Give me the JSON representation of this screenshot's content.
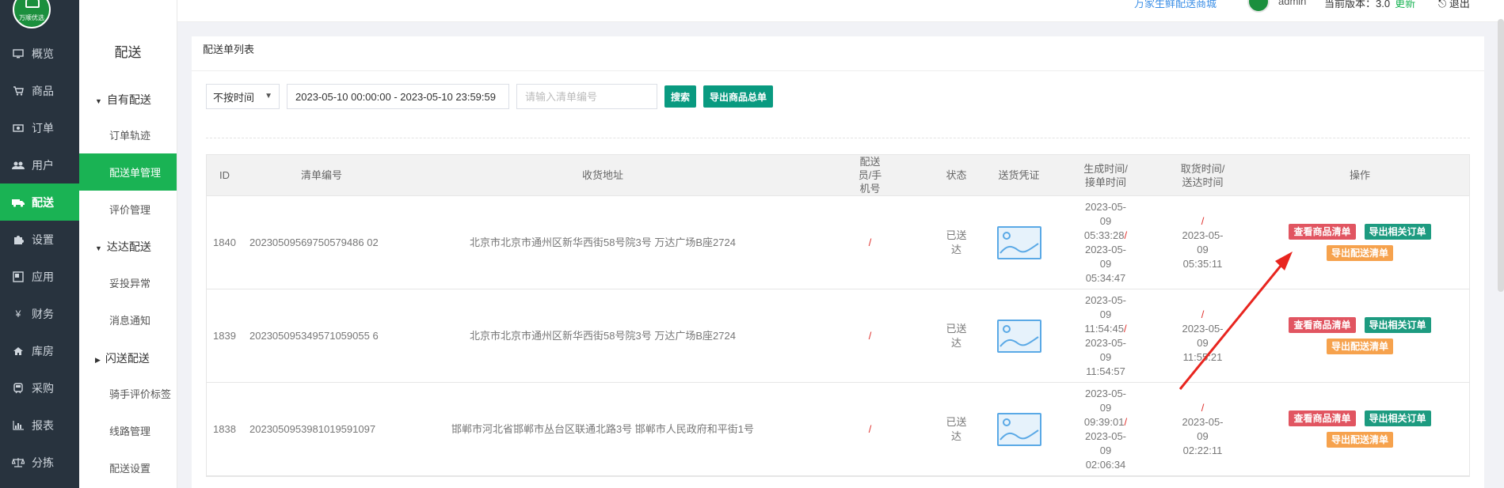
{
  "sidebar": {
    "logo_text": "万顺优选",
    "items": [
      {
        "label": "概览",
        "icon": "monitor-icon"
      },
      {
        "label": "商品",
        "icon": "cart-icon"
      },
      {
        "label": "订单",
        "icon": "money-icon"
      },
      {
        "label": "用户",
        "icon": "users-icon"
      },
      {
        "label": "配送",
        "icon": "truck-icon"
      },
      {
        "label": "设置",
        "icon": "puzzle-icon"
      },
      {
        "label": "应用",
        "icon": "app-icon"
      },
      {
        "label": "财务",
        "icon": "yen-icon"
      },
      {
        "label": "库房",
        "icon": "home-icon"
      },
      {
        "label": "采购",
        "icon": "train-icon"
      },
      {
        "label": "报表",
        "icon": "bar-chart-icon"
      },
      {
        "label": "分拣",
        "icon": "scale-icon"
      }
    ],
    "active_index": 4
  },
  "subsidebar": {
    "title": "配送",
    "groups": [
      {
        "label": "自有配送",
        "expanded": true
      },
      {
        "label": "达达配送",
        "expanded": true
      },
      {
        "label": "闪送配送",
        "expanded": false
      }
    ],
    "items": [
      "订单轨迹",
      "配送单管理",
      "评价管理",
      "妥投异常",
      "消息通知",
      "骑手评价标签",
      "线路管理",
      "配送设置"
    ],
    "active_item": "配送单管理"
  },
  "header": {
    "shop_link": "万家生鲜配送商城",
    "user": "admin",
    "version_label": "当前版本：3.0",
    "update_label": "更新",
    "logout_label": "退出"
  },
  "page": {
    "title": "配送单列表"
  },
  "filters": {
    "time_select": "不按时间",
    "date_range": "2023-05-10 00:00:00 - 2023-05-10 23:59:59",
    "code_placeholder": "请输入清单编号",
    "search_label": "搜索",
    "export_label": "导出商品总单"
  },
  "table": {
    "headers": {
      "id": "ID",
      "no": "清单编号",
      "addr": "收货地址",
      "rider": "配送员/手机号",
      "status": "状态",
      "proof": "送货凭证",
      "gen": "生成时间/接单时间",
      "take": "取货时间/送达时间",
      "op": "操作"
    },
    "rows": [
      {
        "id": "1840",
        "no": "20230509569750579486 02",
        "addr": "北京市北京市通州区新华西街58号院3号 万达广场B座2724",
        "rider": "/",
        "status": "已送达",
        "gen1": "2023-05-09 05:33:28",
        "gen2": "2023-05-09 05:34:47",
        "take1": "/",
        "take2": "2023-05-09 05:35:11"
      },
      {
        "id": "1839",
        "no": "202305095349571059055 6",
        "addr": "北京市北京市通州区新华西街58号院3号 万达广场B座2724",
        "rider": "/",
        "status": "已送达",
        "gen1": "2023-05-09 11:54:45",
        "gen2": "2023-05-09 11:54:57",
        "take1": "/",
        "take2": "2023-05-09 11:55:21"
      },
      {
        "id": "1838",
        "no": "2023050953981019591097",
        "addr": "邯郸市河北省邯郸市丛台区联通北路3号 邯郸市人民政府和平街1号",
        "rider": "/",
        "status": "已送达",
        "gen1": "2023-05-09 09:39:01",
        "gen2": "2023-05-09 02:06:34",
        "take1": "/",
        "take2": "2023-05-09 02:22:11"
      }
    ],
    "op_labels": {
      "view": "查看商品清单",
      "export_orders": "导出相关订单",
      "export_delivery": "导出配送清单"
    }
  },
  "colors": {
    "sidebar_bg": "#28333e",
    "active_green": "#1ab354",
    "teal_button": "#099a80",
    "tag_red": "#e15561",
    "tag_green": "#1d9b80",
    "tag_orange": "#f6a24d",
    "annotation_arrow": "#e8251f"
  }
}
